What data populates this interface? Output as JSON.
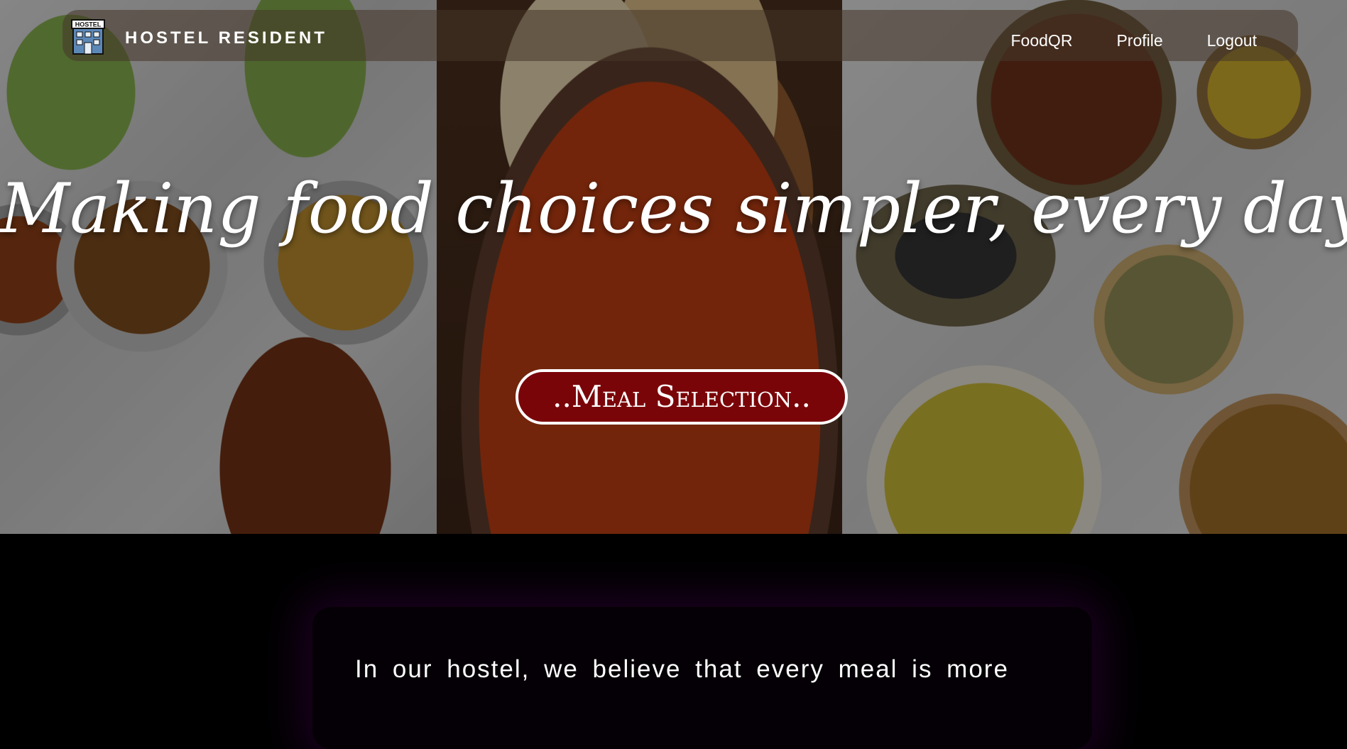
{
  "navbar": {
    "brand_logo_text": "HOSTEL",
    "brand_name": "HOSTEL RESIDENT",
    "links": [
      {
        "label": "FoodQR"
      },
      {
        "label": "Profile"
      },
      {
        "label": "Logout"
      }
    ]
  },
  "hero": {
    "title": "Making food choices simpler, every day",
    "cta_label": "..Meal Selection.."
  },
  "about": {
    "text": "In our hostel, we believe that every meal is more"
  },
  "colors": {
    "cta_background": "#7a0509",
    "page_background": "#000000",
    "card_glow": "#3c0046"
  },
  "icons": {
    "brand_logo": "hostel-building-icon"
  }
}
